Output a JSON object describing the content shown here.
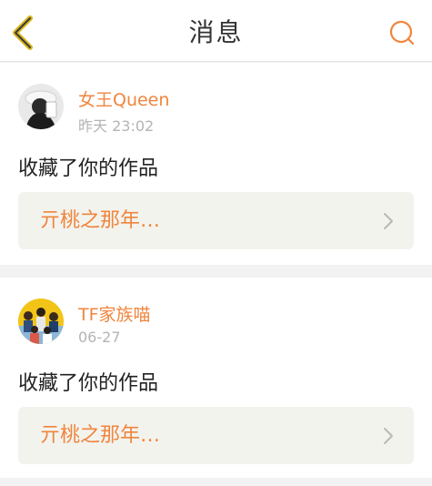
{
  "header": {
    "title": "消息",
    "back_icon": "chevron-left-icon",
    "search_icon": "search-icon",
    "accent_color": "#f0853d"
  },
  "notifications": [
    {
      "username": "女王Queen",
      "time": "昨天 23:02",
      "action": "收藏了你的作品",
      "work_title": "亓桃之那年…"
    },
    {
      "username": "TF家族喵",
      "time": "06-27",
      "action": "收藏了你的作品",
      "work_title": "亓桃之那年…"
    }
  ]
}
